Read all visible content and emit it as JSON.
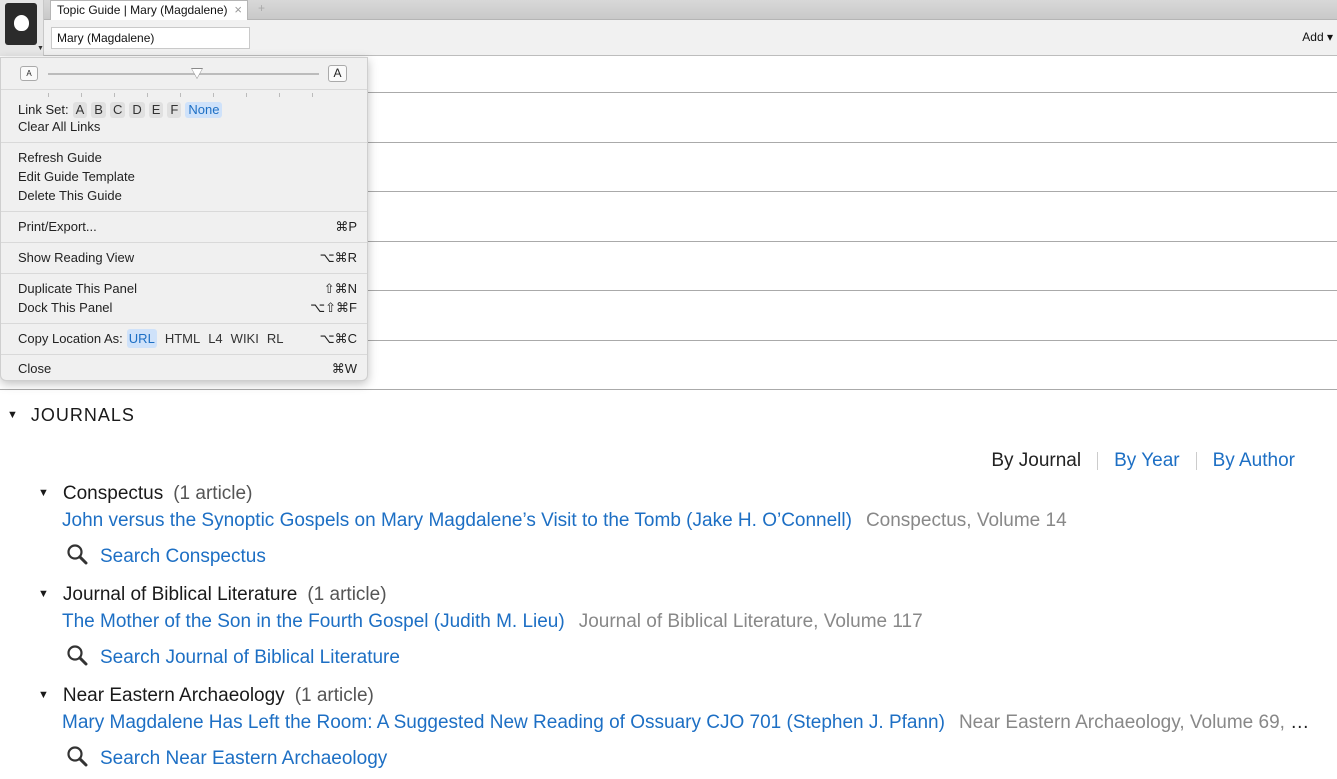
{
  "tab": {
    "title": "Topic Guide | Mary (Magdalene)",
    "close": "×",
    "new": "+"
  },
  "toolbar": {
    "search_value": "Mary (Magdalene)",
    "add_label": "Add ▾"
  },
  "menu": {
    "zoom": {
      "small": "A",
      "large": "A",
      "level": 0.55
    },
    "link_set": {
      "label": "Link Set:",
      "options": [
        "A",
        "B",
        "C",
        "D",
        "E",
        "F",
        "None"
      ],
      "selected": "None"
    },
    "clear_links": "Clear All Links",
    "refresh": "Refresh Guide",
    "edit_template": "Edit Guide Template",
    "delete_guide": "Delete This Guide",
    "print": {
      "label": "Print/Export...",
      "shortcut": "⌘P"
    },
    "reading_view": {
      "label": "Show Reading View",
      "shortcut": "⌥⌘R"
    },
    "duplicate": {
      "label": "Duplicate This Panel",
      "shortcut": "⇧⌘N"
    },
    "dock": {
      "label": "Dock This Panel",
      "shortcut": "⌥⇧⌘F"
    },
    "copy_location": {
      "label": "Copy Location As:",
      "options": [
        "URL",
        "HTML",
        "L4",
        "WIKI",
        "RL"
      ],
      "selected": "URL",
      "shortcut": "⌥⌘C"
    },
    "close": {
      "label": "Close",
      "shortcut": "⌘W"
    }
  },
  "journals": {
    "heading": "JOURNALS",
    "sort": {
      "by_journal": "By Journal",
      "by_year": "By Year",
      "by_author": "By Author",
      "active": "By Journal"
    },
    "items": [
      {
        "name": "Conspectus",
        "count": "(1 article)",
        "article": "John versus the Synoptic Gospels on Mary Magdalene’s Visit to the Tomb (Jake H. O’Connell)",
        "source": "Conspectus, Volume 14",
        "search": "Search Conspectus"
      },
      {
        "name": "Journal of Biblical Literature",
        "count": "(1 article)",
        "article": "The Mother of the Son in the Fourth Gospel (Judith M. Lieu)",
        "source": "Journal of Biblical Literature, Volume 117",
        "search": "Search Journal of Biblical Literature"
      },
      {
        "name": "Near Eastern Archaeology",
        "count": "(1 article)",
        "article": "Mary Magdalene Has Left the Room: A Suggested New Reading of Ossuary CJO 701 (Stephen J. Pfann)",
        "source": "Near Eastern Archaeology, Volume 69, N…",
        "search": "Search Near Eastern Archaeology"
      }
    ]
  }
}
